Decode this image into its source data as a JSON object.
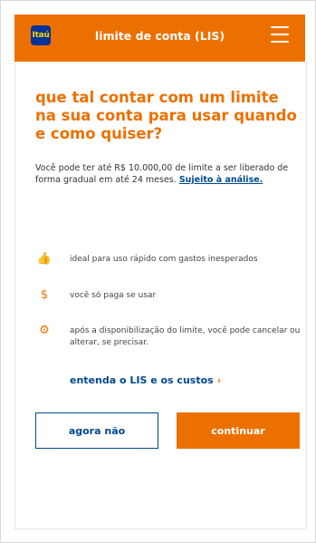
{
  "header": {
    "logo_text": "Itaú",
    "title": "limite de conta (LIS)",
    "menu_icon": "hamburger-menu-icon"
  },
  "main": {
    "headline": "que tal contar com um limite na sua conta para usar quando e como quiser?",
    "description": "Você pode ter até R$ 10.000,00 de limite a ser liberado de forma gradual em até 24 meses.",
    "description_link": "Sujeito à análise.",
    "features": [
      {
        "icon": "thumbs-up-icon",
        "glyph": "👍",
        "text": "ideal para uso rápido com gastos inesperados"
      },
      {
        "icon": "money-icon",
        "glyph": "$",
        "text": "você só paga se usar"
      },
      {
        "icon": "settings-icon",
        "glyph": "⚙",
        "text": "após a disponibilização do limite, você pode cancelar ou alterar, se precisar."
      }
    ],
    "costs_link": "entenda o LIS e os custos"
  },
  "actions": {
    "secondary_label": "agora não",
    "primary_label": "continuar"
  },
  "colors": {
    "brand_orange": "#ec7000",
    "brand_blue": "#004990"
  }
}
